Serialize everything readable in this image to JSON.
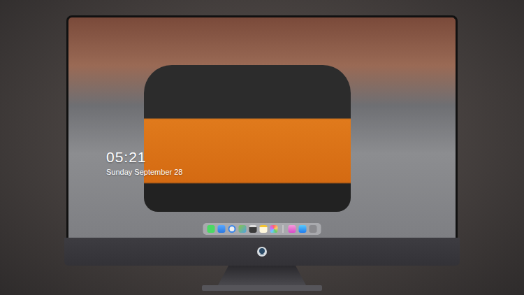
{
  "lock_screen": {
    "time": "05:21",
    "date": "Sunday September 28"
  },
  "dock": {
    "items": [
      {
        "kind": "messages"
      },
      {
        "kind": "mail"
      },
      {
        "kind": "safari"
      },
      {
        "kind": "maps"
      },
      {
        "kind": "video"
      },
      {
        "kind": "notes"
      },
      {
        "kind": "photos"
      },
      {
        "kind": "separator"
      },
      {
        "kind": "music"
      },
      {
        "kind": "appstore"
      },
      {
        "kind": "camera"
      }
    ]
  }
}
